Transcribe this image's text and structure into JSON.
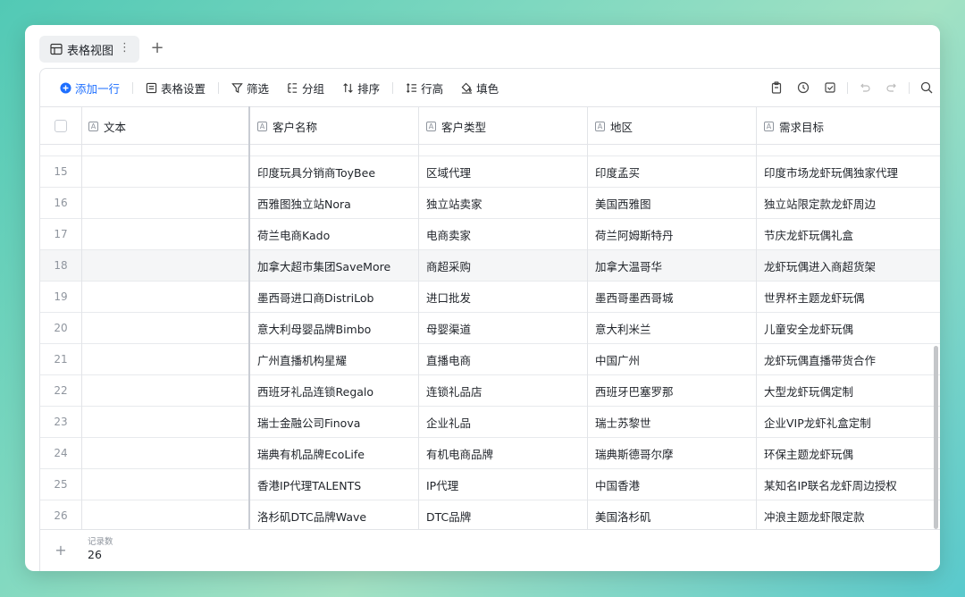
{
  "view_tab": {
    "label": "表格视图",
    "more": "⋮",
    "add": "+"
  },
  "toolbar": {
    "add_row": "添加一行",
    "table_settings": "表格设置",
    "filter": "筛选",
    "group": "分组",
    "sort": "排序",
    "row_height": "行高",
    "fill": "填色"
  },
  "columns": [
    "文本",
    "客户名称",
    "客户类型",
    "地区",
    "需求目标"
  ],
  "rows": [
    {
      "num": "15",
      "name": "印度玩具分销商ToyBee",
      "type": "区域代理",
      "region": "印度孟买",
      "goal": "印度市场龙虾玩偶独家代理"
    },
    {
      "num": "16",
      "name": "西雅图独立站Nora",
      "type": "独立站卖家",
      "region": "美国西雅图",
      "goal": "独立站限定款龙虾周边"
    },
    {
      "num": "17",
      "name": "荷兰电商Kado",
      "type": "电商卖家",
      "region": "荷兰阿姆斯特丹",
      "goal": "节庆龙虾玩偶礼盒"
    },
    {
      "num": "18",
      "name": "加拿大超市集团SaveMore",
      "type": "商超采购",
      "region": "加拿大温哥华",
      "goal": "龙虾玩偶进入商超货架"
    },
    {
      "num": "19",
      "name": "墨西哥进口商DistriLob",
      "type": "进口批发",
      "region": "墨西哥墨西哥城",
      "goal": "世界杯主题龙虾玩偶"
    },
    {
      "num": "20",
      "name": "意大利母婴品牌Bimbo",
      "type": "母婴渠道",
      "region": "意大利米兰",
      "goal": "儿童安全龙虾玩偶"
    },
    {
      "num": "21",
      "name": "广州直播机构星耀",
      "type": "直播电商",
      "region": "中国广州",
      "goal": "龙虾玩偶直播带货合作"
    },
    {
      "num": "22",
      "name": "西班牙礼品连锁Regalo",
      "type": "连锁礼品店",
      "region": "西班牙巴塞罗那",
      "goal": "大型龙虾玩偶定制"
    },
    {
      "num": "23",
      "name": "瑞士金融公司Finova",
      "type": "企业礼品",
      "region": "瑞士苏黎世",
      "goal": "企业VIP龙虾礼盒定制"
    },
    {
      "num": "24",
      "name": "瑞典有机品牌EcoLife",
      "type": "有机电商品牌",
      "region": "瑞典斯德哥尔摩",
      "goal": "环保主题龙虾玩偶"
    },
    {
      "num": "25",
      "name": "香港IP代理TALENTS",
      "type": "IP代理",
      "region": "中国香港",
      "goal": "某知名IP联名龙虾周边授权"
    },
    {
      "num": "26",
      "name": "洛杉矶DTC品牌Wave",
      "type": "DTC品牌",
      "region": "美国洛杉矶",
      "goal": "冲浪主题龙虾限定款"
    }
  ],
  "footer": {
    "add": "+",
    "count_label": "记录数",
    "count": "26"
  }
}
